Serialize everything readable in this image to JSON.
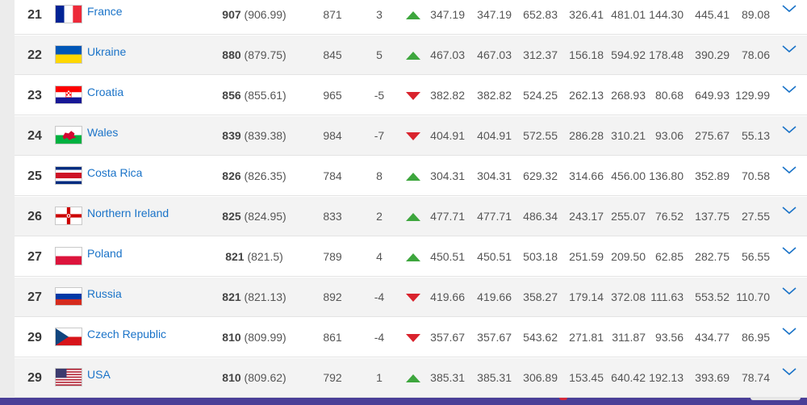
{
  "colors": {
    "team_link": "#1a73c8",
    "arrow_up": "#3da63d",
    "arrow_down": "#d9232d",
    "chevron": "#1a73c8",
    "bottom_bar": "#4a3f97"
  },
  "rows": [
    {
      "rank": "21",
      "team": "France",
      "flag": "france-flag",
      "points": "907",
      "points_exact": "(906.99)",
      "prev": "871",
      "change": "3",
      "trend": "up",
      "v1": "347.19",
      "v2": "347.19",
      "v3": "652.83",
      "v4": "326.41",
      "v5": "481.01",
      "v6": "144.30",
      "v7": "445.41",
      "v8": "89.08"
    },
    {
      "rank": "22",
      "team": "Ukraine",
      "flag": "ukraine-flag",
      "points": "880",
      "points_exact": "(879.75)",
      "prev": "845",
      "change": "5",
      "trend": "up",
      "v1": "467.03",
      "v2": "467.03",
      "v3": "312.37",
      "v4": "156.18",
      "v5": "594.92",
      "v6": "178.48",
      "v7": "390.29",
      "v8": "78.06"
    },
    {
      "rank": "23",
      "team": "Croatia",
      "flag": "croatia-flag",
      "points": "856",
      "points_exact": "(855.61)",
      "prev": "965",
      "change": "-5",
      "trend": "down",
      "v1": "382.82",
      "v2": "382.82",
      "v3": "524.25",
      "v4": "262.13",
      "v5": "268.93",
      "v6": "80.68",
      "v7": "649.93",
      "v8": "129.99"
    },
    {
      "rank": "24",
      "team": "Wales",
      "flag": "wales-flag",
      "points": "839",
      "points_exact": "(839.38)",
      "prev": "984",
      "change": "-7",
      "trend": "down",
      "v1": "404.91",
      "v2": "404.91",
      "v3": "572.55",
      "v4": "286.28",
      "v5": "310.21",
      "v6": "93.06",
      "v7": "275.67",
      "v8": "55.13"
    },
    {
      "rank": "25",
      "team": "Costa Rica",
      "flag": "costa-rica-flag",
      "points": "826",
      "points_exact": "(826.35)",
      "prev": "784",
      "change": "8",
      "trend": "up",
      "v1": "304.31",
      "v2": "304.31",
      "v3": "629.32",
      "v4": "314.66",
      "v5": "456.00",
      "v6": "136.80",
      "v7": "352.89",
      "v8": "70.58"
    },
    {
      "rank": "26",
      "team": "Northern Ireland",
      "flag": "northern-ireland-flag",
      "points": "825",
      "points_exact": "(824.95)",
      "prev": "833",
      "change": "2",
      "trend": "up",
      "v1": "477.71",
      "v2": "477.71",
      "v3": "486.34",
      "v4": "243.17",
      "v5": "255.07",
      "v6": "76.52",
      "v7": "137.75",
      "v8": "27.55"
    },
    {
      "rank": "27",
      "team": "Poland",
      "flag": "poland-flag",
      "points": "821",
      "points_exact": "(821.5)",
      "prev": "789",
      "change": "4",
      "trend": "up",
      "v1": "450.51",
      "v2": "450.51",
      "v3": "503.18",
      "v4": "251.59",
      "v5": "209.50",
      "v6": "62.85",
      "v7": "282.75",
      "v8": "56.55"
    },
    {
      "rank": "27",
      "team": "Russia",
      "flag": "russia-flag",
      "points": "821",
      "points_exact": "(821.13)",
      "prev": "892",
      "change": "-4",
      "trend": "down",
      "v1": "419.66",
      "v2": "419.66",
      "v3": "358.27",
      "v4": "179.14",
      "v5": "372.08",
      "v6": "111.63",
      "v7": "553.52",
      "v8": "110.70"
    },
    {
      "rank": "29",
      "team": "Czech Republic",
      "flag": "czech-republic-flag",
      "points": "810",
      "points_exact": "(809.99)",
      "prev": "861",
      "change": "-4",
      "trend": "down",
      "v1": "357.67",
      "v2": "357.67",
      "v3": "543.62",
      "v4": "271.81",
      "v5": "311.87",
      "v6": "93.56",
      "v7": "434.77",
      "v8": "86.95"
    },
    {
      "rank": "29",
      "team": "USA",
      "flag": "usa-flag",
      "points": "810",
      "points_exact": "(809.62)",
      "prev": "792",
      "change": "1",
      "trend": "up",
      "v1": "385.31",
      "v2": "385.31",
      "v3": "306.89",
      "v4": "153.45",
      "v5": "640.42",
      "v6": "192.13",
      "v7": "393.69",
      "v8": "78.74"
    }
  ]
}
